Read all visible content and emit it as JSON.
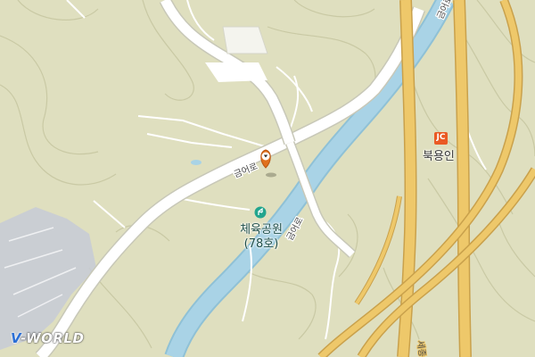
{
  "map": {
    "colors": {
      "land": "#dfdfbf",
      "contour": "#c9c9a4",
      "river": "#a9d3e6",
      "riverEdge": "#8fc1d6",
      "road": "#ffffff",
      "roadEdge": "#c8c8b8",
      "expressway": "#eec86a",
      "expresswayEdge": "#c9a14c",
      "urban": "#c7cbd6"
    },
    "labels": {
      "road_upper": "금어로",
      "road_middle": "금어로",
      "road_lower": "금어로",
      "expressway_south": "세종",
      "park_name": "체육공원",
      "park_sub": "(78호)",
      "junction_badge": "JC",
      "junction_name": "북용인"
    },
    "watermark": {
      "v": "V",
      "rest": "-WORLD"
    }
  }
}
